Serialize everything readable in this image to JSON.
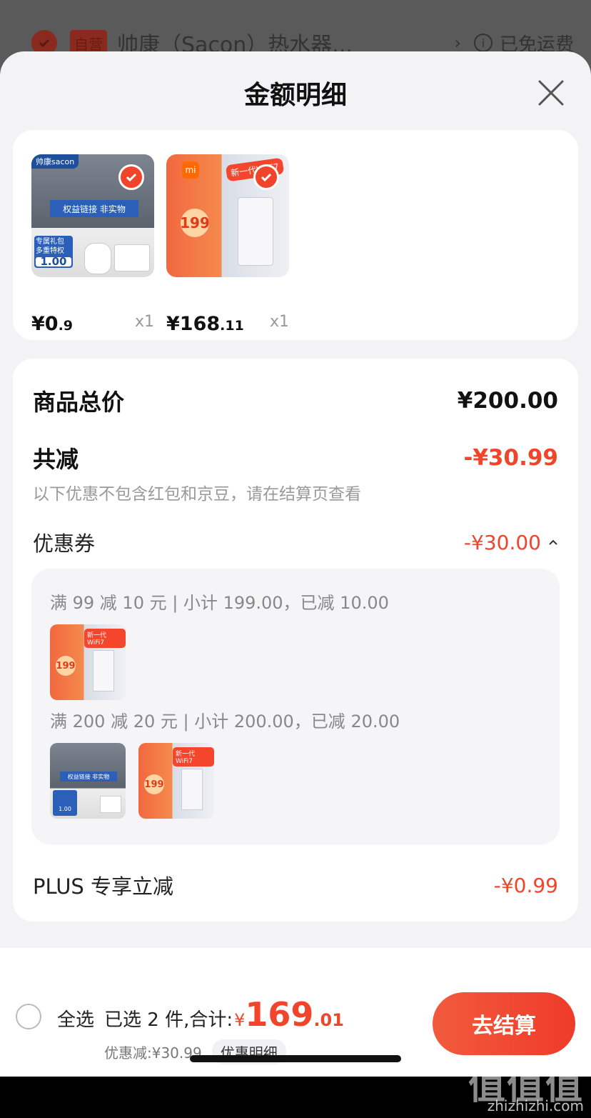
{
  "background_row": {
    "self_tag": "自营",
    "title": "帅康（Sacon）热水器...",
    "shipping": "已免运费"
  },
  "sheet": {
    "title": "金额明细"
  },
  "products": [
    {
      "price_int": "¥0",
      "price_dec": ".9",
      "qty": "x1",
      "overlay_text": "权益链接  非实物",
      "tag1": "专属礼包",
      "tag2": "多重特权",
      "tag_price": "1.00",
      "brand": "帅康sacon"
    },
    {
      "price_int": "¥168",
      "price_dec": ".11",
      "qty": "x1",
      "overlay_text": "新一代WiFi7",
      "promo_price": "199",
      "brand": "mi"
    }
  ],
  "detail": {
    "total_label": "商品总价",
    "total_value": "¥200.00",
    "reduce_label": "共减",
    "reduce_value": "-¥30.99",
    "reduce_note": "以下优惠不包含红包和京豆，请在结算页查看",
    "coupon_label": "优惠券",
    "coupon_value": "-¥30.00",
    "coupons": [
      {
        "text": "满 99 减 10 元 | 小计 199.00，已减 10.00"
      },
      {
        "text": "满 200 减 20 元 | 小计 200.00，已减 20.00"
      }
    ],
    "plus_label": "PLUS 专享立减",
    "plus_value": "-¥0.99"
  },
  "bottom_bar": {
    "select_all": "全选",
    "summary_text": "已选 2 件,合计:",
    "yen": "¥",
    "total_int": "169",
    "total_dec": ".01",
    "discount_text": "优惠减:¥30.99",
    "discount_detail_button": "优惠明细",
    "checkout_button": "去结算"
  },
  "watermark": {
    "big": "值值值",
    "small": "zhizhizhi.com"
  },
  "colors": {
    "accent": "#f0452a",
    "sheet_bg": "#f3f3f5"
  }
}
